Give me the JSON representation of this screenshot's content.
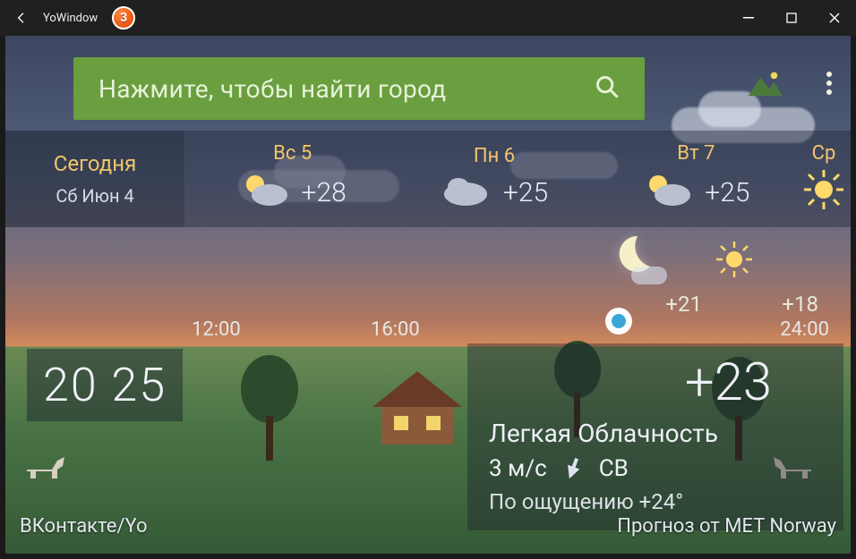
{
  "window": {
    "title": "YoWindow",
    "badge": "3"
  },
  "search": {
    "placeholder": "Нажмите, чтобы найти город"
  },
  "forecast": {
    "today_label": "Сегодня",
    "today_date": "Сб Июн 4",
    "days": [
      {
        "label": "Вс 5",
        "temp": "+28",
        "icon": "partly-cloudy"
      },
      {
        "label": "Пн 6",
        "temp": "+25",
        "icon": "cloudy"
      },
      {
        "label": "Вт 7",
        "temp": "+25",
        "icon": "partly-cloudy"
      },
      {
        "label": "Ср",
        "temp": "",
        "icon": "sunny"
      }
    ],
    "night": {
      "n1": "+21",
      "n2": "+18"
    }
  },
  "hours": {
    "h12": "12:00",
    "h16": "16:00",
    "h24": "24:00"
  },
  "clock": {
    "time": "20 25"
  },
  "current": {
    "temp": "+23",
    "desc": "Легкая Облачность",
    "wind_speed": "3 м/с",
    "wind_dir": "СВ",
    "feels": "По ощущению +24°"
  },
  "footer": {
    "left": "ВКонтакте/Yo",
    "right": "Прогноз от MET Norway"
  }
}
